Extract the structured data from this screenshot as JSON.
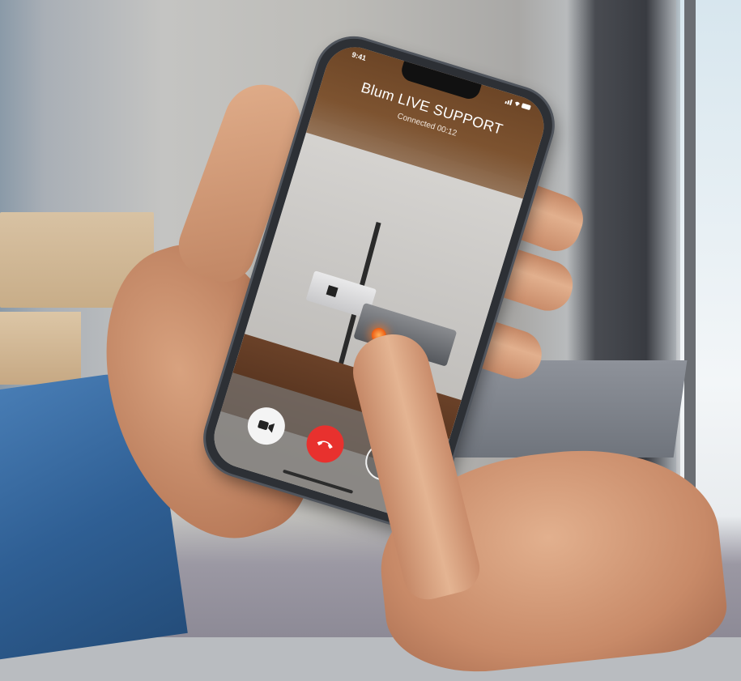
{
  "phone": {
    "status_bar": {
      "time": "9:41",
      "icons": "signal-icon wifi-icon battery-icon"
    },
    "call": {
      "title": "Blum LIVE SUPPORT",
      "status": "Connected 00:12"
    },
    "controls": [
      {
        "name": "video-camera-icon"
      },
      {
        "name": "end-call-icon",
        "color": "#e8312e"
      },
      {
        "name": "speaker-icon"
      }
    ]
  },
  "colors": {
    "header_brown": "#7d5330",
    "end_call_red": "#e8312e",
    "marker_orange": "#f0651a",
    "sleeve_blue": "#2f5f94"
  }
}
